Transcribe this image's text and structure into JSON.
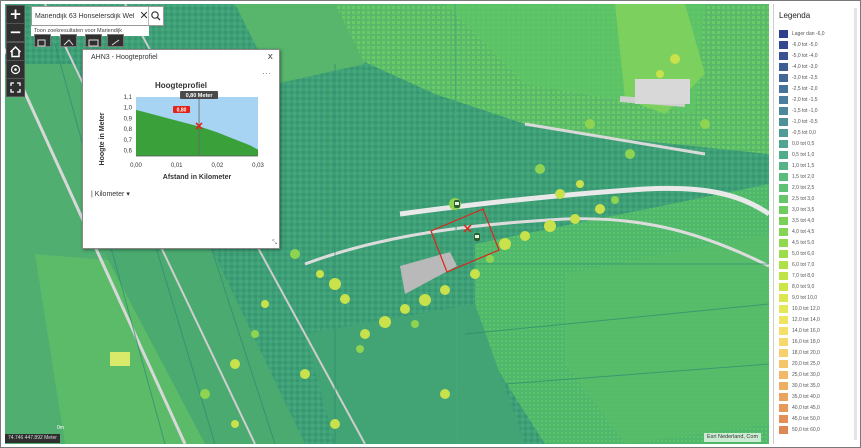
{
  "search": {
    "value": "Mariendijk 63 Honselersdijk Wel",
    "clear_glyph": "✕",
    "suggestion": "Toon zoekresultaten voor Mariendijk"
  },
  "zoom": {
    "in": "+",
    "out": "−"
  },
  "panel": {
    "title": "AHN3 - Hoogteprofiel",
    "close": "x",
    "more": "···",
    "unit_label": "Kilometer",
    "unit_caret": "▾",
    "resize": "⤡"
  },
  "chart_data": {
    "type": "area",
    "title": "Hoogteprofiel",
    "xlabel": "Afstand in Kilometer",
    "ylabel": "Hoogte in Meter",
    "xlim": [
      0,
      0.03
    ],
    "ylim": [
      0.55,
      1.1
    ],
    "x_ticks": [
      "0,00",
      "0,01",
      "0,02",
      "0,03"
    ],
    "y_ticks": [
      "1,1",
      "1,0",
      "0,9",
      "0,8",
      "0,7",
      "0,6"
    ],
    "x": [
      0,
      0.004,
      0.008,
      0.012,
      0.016,
      0.02,
      0.024,
      0.028,
      0.0305
    ],
    "y": [
      0.98,
      0.94,
      0.9,
      0.86,
      0.82,
      0.77,
      0.71,
      0.65,
      0.61
    ],
    "cursor": {
      "x": 0.0155,
      "y": 0.83
    },
    "tooltip_top": "0,80 Meter",
    "tooltip_value": "0,80",
    "fill_color": "#3aa13a",
    "sky_color": "#a6d4f2",
    "marker_color": "#e2231a"
  },
  "legend": {
    "title": "Legenda",
    "items": [
      {
        "label": "Lager dan -6,0",
        "color": "#2e3f8c"
      },
      {
        "label": "-6,0 tot -5,0",
        "color": "#34488f"
      },
      {
        "label": "-5,0 tot -4,0",
        "color": "#3b5292"
      },
      {
        "label": "-4,0 tot -3,0",
        "color": "#3f5d95"
      },
      {
        "label": "-3,0 tot -2,5",
        "color": "#436898"
      },
      {
        "label": "-2,5 tot -2,0",
        "color": "#47739a"
      },
      {
        "label": "-2,0 tot -1,5",
        "color": "#4a7e9c"
      },
      {
        "label": "-1,5 tot -1,0",
        "color": "#4c889c"
      },
      {
        "label": "-1,0 tot -0,5",
        "color": "#4d929b"
      },
      {
        "label": "-0,5 tot 0,0",
        "color": "#4e9b97"
      },
      {
        "label": "0,0 tot 0,5",
        "color": "#4fa493"
      },
      {
        "label": "0,5 tot 1,0",
        "color": "#51ac8c"
      },
      {
        "label": "1,0 tot 1,5",
        "color": "#55b385"
      },
      {
        "label": "1,5 tot 2,0",
        "color": "#5abb7c"
      },
      {
        "label": "2,0 tot 2,5",
        "color": "#5fc173"
      },
      {
        "label": "2,5 tot 3,0",
        "color": "#66c76a"
      },
      {
        "label": "3,0 tot 3,5",
        "color": "#6ecc61"
      },
      {
        "label": "3,5 tot 4,0",
        "color": "#78d159"
      },
      {
        "label": "4,0 tot 4,5",
        "color": "#84d553"
      },
      {
        "label": "4,5 tot 5,0",
        "color": "#90d94e"
      },
      {
        "label": "5,0 tot 6,0",
        "color": "#9edd4a"
      },
      {
        "label": "6,0 tot 7,0",
        "color": "#aee048"
      },
      {
        "label": "7,0 tot 8,0",
        "color": "#bee348"
      },
      {
        "label": "8,0 tot 9,0",
        "color": "#cde54b"
      },
      {
        "label": "9,0 tot 10,0",
        "color": "#dbe651"
      },
      {
        "label": "10,0 tot 12,0",
        "color": "#e6e659"
      },
      {
        "label": "12,0 tot 14,0",
        "color": "#efe462"
      },
      {
        "label": "14,0 tot 16,0",
        "color": "#f4df69"
      },
      {
        "label": "16,0 tot 18,0",
        "color": "#f6d86d"
      },
      {
        "label": "18,0 tot 20,0",
        "color": "#f6cf6e"
      },
      {
        "label": "20,0 tot 25,0",
        "color": "#f5c56c"
      },
      {
        "label": "25,0 tot 30,0",
        "color": "#f2ba68"
      },
      {
        "label": "30,0 tot 35,0",
        "color": "#eeaf63"
      },
      {
        "label": "35,0 tot 40,0",
        "color": "#eaa45e"
      },
      {
        "label": "40,0 tot 45,0",
        "color": "#e69a5a"
      },
      {
        "label": "45,0 tot 50,0",
        "color": "#e29057"
      },
      {
        "label": "50,0 tot 60,0",
        "color": "#dd8755"
      }
    ]
  },
  "footer": {
    "coords": "74.746 447.892 Meter",
    "attribution": "Esri Nederland, Com",
    "scale": "0m"
  }
}
